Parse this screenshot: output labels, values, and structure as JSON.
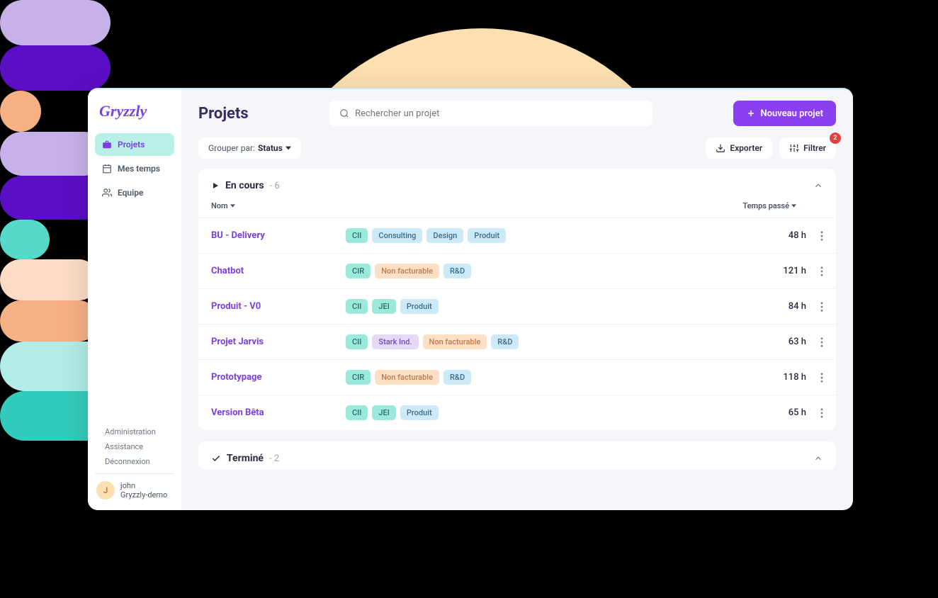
{
  "brand": "Gryzzly",
  "sidebar": {
    "items": [
      {
        "label": "Projets",
        "icon": "briefcase",
        "active": true
      },
      {
        "label": "Mes temps",
        "icon": "calendar",
        "active": false
      },
      {
        "label": "Equipe",
        "icon": "people",
        "active": false
      }
    ],
    "footer": {
      "admin": "Administration",
      "assist": "Assistance",
      "logout": "Déconnexion"
    },
    "user": {
      "initial": "J",
      "name": "john",
      "org": "Gryzzly-demo"
    }
  },
  "header": {
    "title": "Projets",
    "search_placeholder": "Rechercher un projet",
    "new_button": "Nouveau projet"
  },
  "controls": {
    "group_by_label": "Grouper par:",
    "group_by_value": "Status",
    "export": "Exporter",
    "filter": "Filtrer",
    "filter_count": "2"
  },
  "columns": {
    "name": "Nom",
    "time": "Temps passé"
  },
  "groups": [
    {
      "status": "En cours",
      "count": "- 6",
      "icon": "play",
      "rows": [
        {
          "name": "BU - Delivery",
          "time": "48 h",
          "tags": [
            {
              "t": "CII",
              "c": "teal"
            },
            {
              "t": "Consulting",
              "c": "blue"
            },
            {
              "t": "Design",
              "c": "blue"
            },
            {
              "t": "Produit",
              "c": "blue"
            }
          ]
        },
        {
          "name": "Chatbot",
          "time": "121 h",
          "tags": [
            {
              "t": "CIR",
              "c": "teal"
            },
            {
              "t": "Non facturable",
              "c": "orange"
            },
            {
              "t": "R&D",
              "c": "blue"
            }
          ]
        },
        {
          "name": "Produit - V0",
          "time": "84 h",
          "tags": [
            {
              "t": "CII",
              "c": "teal"
            },
            {
              "t": "JEI",
              "c": "teal"
            },
            {
              "t": "Produit",
              "c": "blue"
            }
          ]
        },
        {
          "name": "Projet Jarvis",
          "time": "63 h",
          "tags": [
            {
              "t": "CII",
              "c": "teal"
            },
            {
              "t": "Stark Ind.",
              "c": "purple"
            },
            {
              "t": "Non facturable",
              "c": "orange"
            },
            {
              "t": "R&D",
              "c": "blue"
            }
          ]
        },
        {
          "name": "Prototypage",
          "time": "118 h",
          "tags": [
            {
              "t": "CIR",
              "c": "teal"
            },
            {
              "t": "Non facturable",
              "c": "orange"
            },
            {
              "t": "R&D",
              "c": "blue"
            }
          ]
        },
        {
          "name": "Version Bêta",
          "time": "65 h",
          "tags": [
            {
              "t": "CII",
              "c": "teal"
            },
            {
              "t": "JEI",
              "c": "teal"
            },
            {
              "t": "Produit",
              "c": "blue"
            }
          ]
        }
      ]
    },
    {
      "status": "Terminé",
      "count": "- 2",
      "icon": "check",
      "rows": []
    }
  ]
}
